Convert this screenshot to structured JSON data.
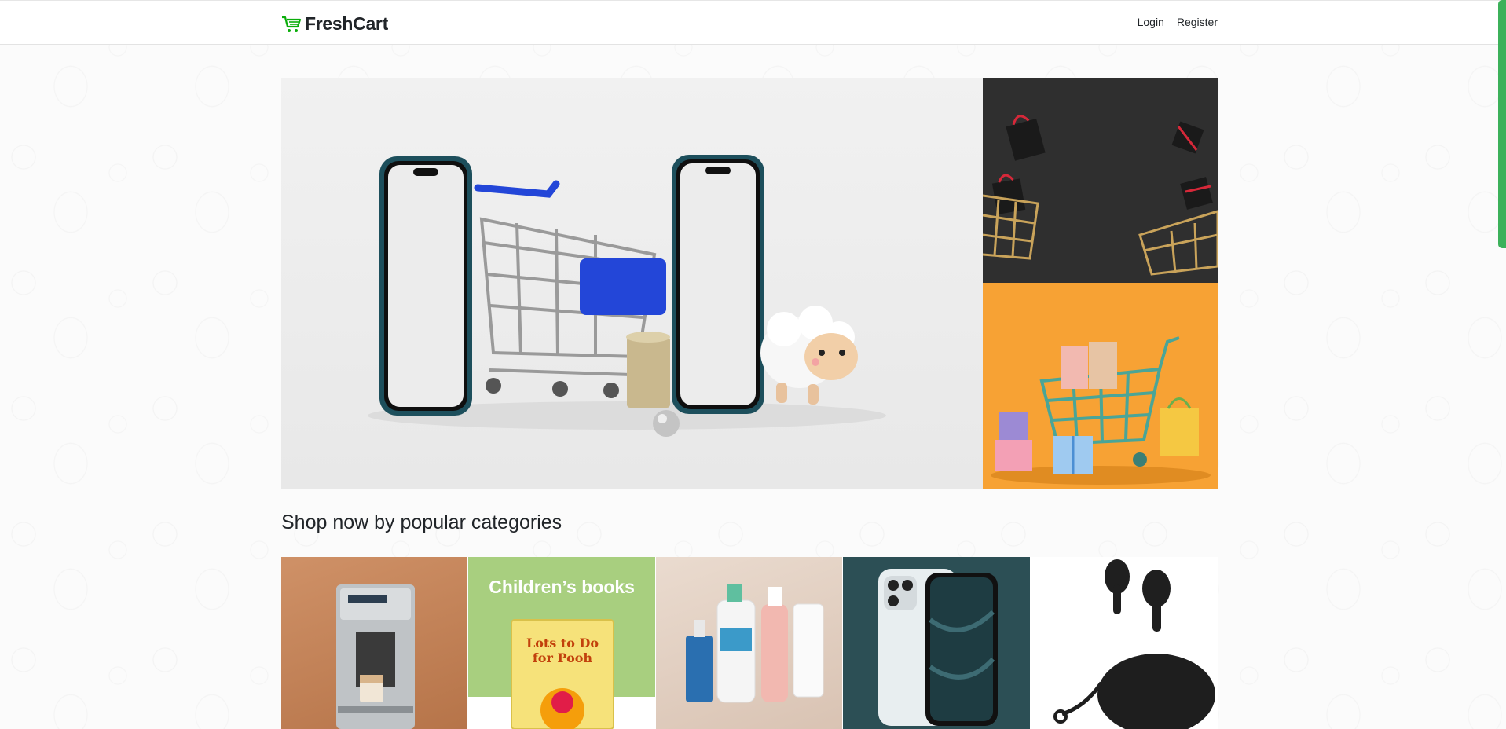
{
  "brand": {
    "name": "FreshCart",
    "icon": "cart-icon",
    "color": "#0aad0a"
  },
  "nav": {
    "login": "Login",
    "register": "Register"
  },
  "hero": {
    "main_slide": "phones-and-shopping-cart",
    "side_top": "gift-bags-and-carts-dark",
    "side_bottom": "cart-with-gifts-orange"
  },
  "section": {
    "title": "Shop now by popular categories"
  },
  "categories": [
    {
      "label": "",
      "image": "coffee-machine"
    },
    {
      "label": "Children’s books",
      "image": "childrens-book"
    },
    {
      "label": "",
      "image": "skincare-products"
    },
    {
      "label": "",
      "image": "smartphone"
    },
    {
      "label": "",
      "image": "wireless-earbuds"
    }
  ],
  "colors": {
    "accent": "#3cb15a",
    "text": "#212529"
  }
}
